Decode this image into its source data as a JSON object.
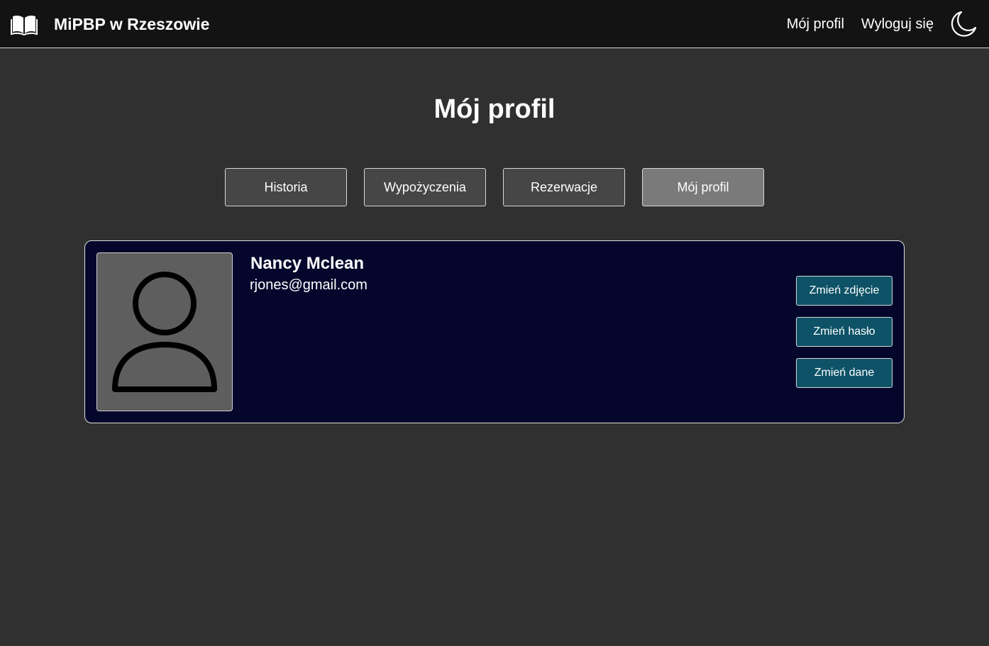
{
  "navbar": {
    "brand_icon": "open-book-icon",
    "brand_title": "MiPBP w Rzeszowie",
    "links": [
      {
        "label": "Mój profil"
      },
      {
        "label": "Wyloguj się"
      }
    ],
    "theme_icon": "moon-icon"
  },
  "page": {
    "title": "Mój profil"
  },
  "tabs": [
    {
      "label": "Historia",
      "active": false
    },
    {
      "label": "Wypożyczenia",
      "active": false
    },
    {
      "label": "Rezerwacje",
      "active": false
    },
    {
      "label": "Mój profil",
      "active": true
    }
  ],
  "profile": {
    "avatar_icon": "user-silhouette-icon",
    "name": "Nancy Mclean",
    "email": "rjones@gmail.com",
    "actions": [
      {
        "label": "Zmień zdjęcie"
      },
      {
        "label": "Zmień hasło"
      },
      {
        "label": "Zmień dane"
      }
    ]
  },
  "colors": {
    "background": "#303030",
    "navbar": "#131313",
    "tab": "#464646",
    "tab_active": "#7a7a7a",
    "card": "#04072b",
    "action_button": "#0d5267",
    "avatar_bg": "#5e5e5e"
  }
}
